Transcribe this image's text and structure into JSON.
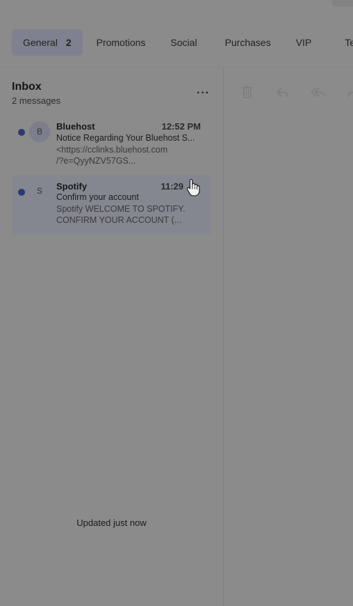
{
  "tabs": [
    {
      "label": "General",
      "count": "2"
    },
    {
      "label": "Promotions"
    },
    {
      "label": "Social"
    },
    {
      "label": "Purchases"
    },
    {
      "label": "VIP"
    },
    {
      "label": "Tes"
    }
  ],
  "inbox": {
    "title": "Inbox",
    "count_label": "2 messages",
    "more_label": "···"
  },
  "messages": [
    {
      "avatar": "B",
      "sender": "Bluehost",
      "time": "12:52 PM",
      "subject": "Notice Regarding Your Bluehost S...",
      "preview_line1": "<https://cclinks.bluehost.com",
      "preview_line2": "/?e=QyyNZV57GS..."
    },
    {
      "avatar": "S",
      "sender": "Spotify",
      "time": "11:29",
      "subject": "Confirm your account",
      "preview_line1": "Spotify WELCOME TO SPOTIFY.",
      "preview_line2": "CONFIRM YOUR ACCOUNT (..."
    }
  ],
  "status": "Updated just now",
  "toolbar_icons": [
    "trash-icon",
    "reply-icon",
    "reply-all-icon",
    "forward-icon"
  ],
  "colors": {
    "unread_dot": "#2a3a6e",
    "active_tab": "#7f8190",
    "background": "#8b8b8b"
  }
}
